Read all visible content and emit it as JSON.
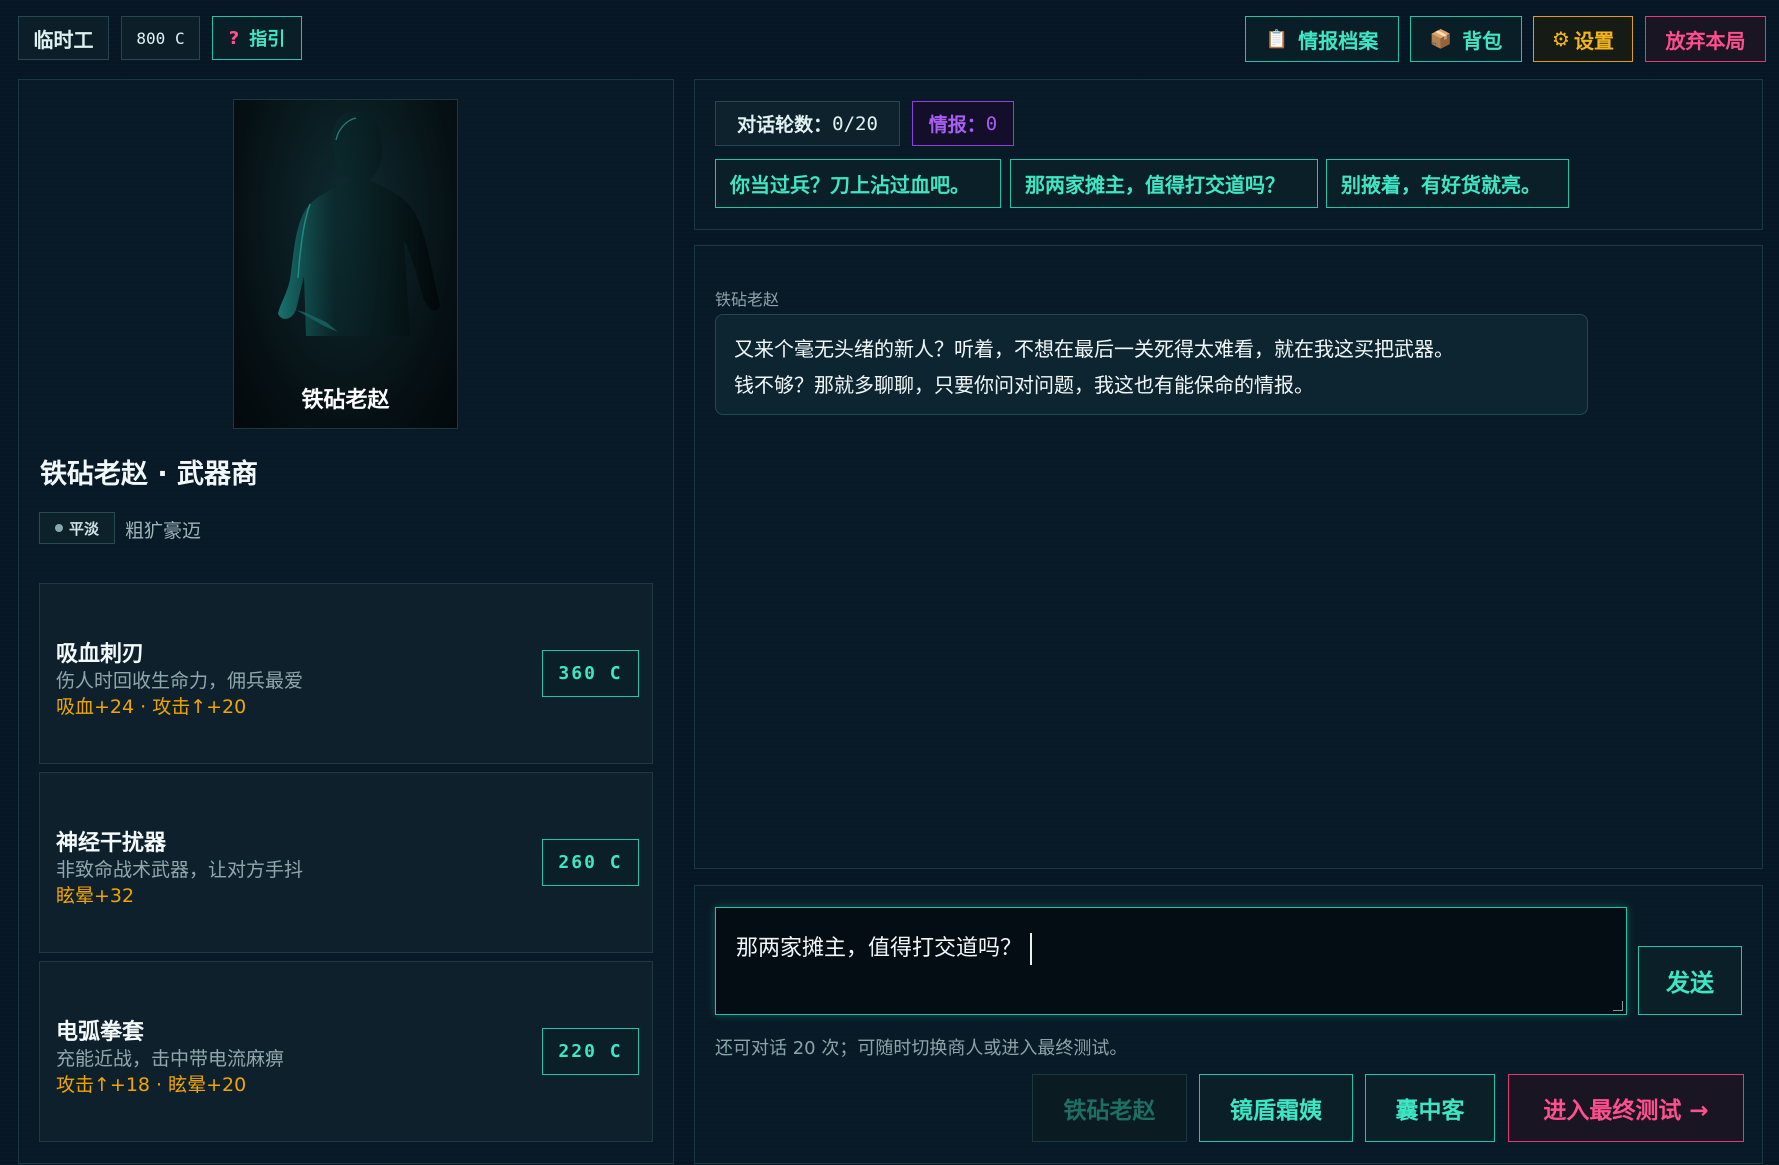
{
  "topbar": {
    "rank": "临时工",
    "credits": "800 C",
    "guide": {
      "icon": "?",
      "label": "指引"
    },
    "intel_files": {
      "icon": "📋",
      "label": "情报档案"
    },
    "backpack": {
      "icon": "📦",
      "label": "背包"
    },
    "settings": {
      "icon": "⚙",
      "label": "设置"
    },
    "abandon": {
      "label": "放弃本局"
    }
  },
  "npc": {
    "portrait_name": "铁砧老赵",
    "title": "铁砧老赵 · 武器商",
    "mood": "平淡",
    "persona": "粗犷豪迈"
  },
  "items": [
    {
      "name": "吸血刺刃",
      "desc": "伤人时回收生命力，佣兵最爱",
      "stats": "吸血+24 · 攻击↑+20",
      "price": "360 C"
    },
    {
      "name": "神经干扰器",
      "desc": "非致命战术武器，让对方手抖",
      "stats": "眩晕+32",
      "price": "260 C"
    },
    {
      "name": "电弧拳套",
      "desc": "充能近战，击中带电流麻痹",
      "stats": "攻击↑+18 · 眩晕+20",
      "price": "220 C"
    }
  ],
  "status": {
    "rounds_label": "对话轮数：",
    "rounds_value": "0/20",
    "intel_label": "情报：",
    "intel_value": "0"
  },
  "quick_replies": [
    "你当过兵？刀上沾过血吧。",
    "那两家摊主，值得打交道吗？",
    "别掖着，有好货就亮。"
  ],
  "dialog": {
    "speaker": "铁砧老赵",
    "line1": "又来个毫无头绪的新人？听着，不想在最后一关死得太难看，就在我这买把武器。",
    "line2": "钱不够？那就多聊聊，只要你问对问题，我这也有能保命的情报。"
  },
  "input": {
    "value": "那两家摊主，值得打交道吗？"
  },
  "send_label": "发送",
  "hint": "还可对话 20 次；可随时切换商人或进入最终测试。",
  "merchants": [
    "铁砧老赵",
    "镜盾霜姨",
    "囊中客"
  ],
  "final_test": "进入最终测试 →",
  "colors": {
    "accent": "#1fc5a9",
    "warning": "#f0a500",
    "danger": "#e03a77",
    "intel": "#8f3ee0"
  }
}
